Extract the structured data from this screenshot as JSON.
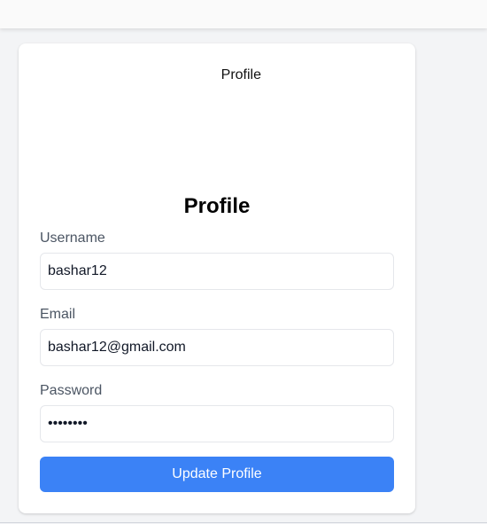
{
  "profile": {
    "avatar_alt": "Profile",
    "title": "Profile",
    "username_label": "Username",
    "username_value": "bashar12",
    "email_label": "Email",
    "email_value": "bashar12@gmail.com",
    "password_label": "Password",
    "password_value": "password",
    "submit_label": "Update Profile"
  },
  "colors": {
    "accent": "#3b82f6",
    "page_background": "#f3f4f6",
    "card_background": "#ffffff"
  }
}
